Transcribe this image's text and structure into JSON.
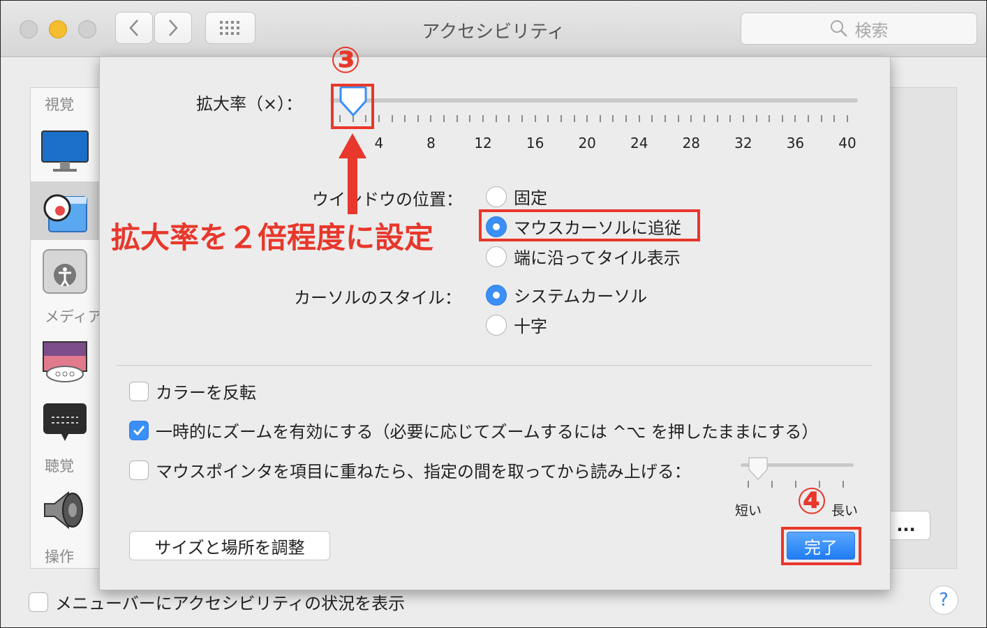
{
  "window": {
    "title": "アクセシビリティ"
  },
  "search": {
    "placeholder": "検索"
  },
  "sidebar": {
    "categories": {
      "vision": "視覚",
      "media": "メディア",
      "hearing": "聴覚",
      "interaction": "操作"
    }
  },
  "options_button_label": "...",
  "bottom": {
    "show_status_label": "メニューバーにアクセシビリティの状況を表示",
    "help_label": "?"
  },
  "sheet": {
    "magnification": {
      "label": "拡大率（×）：",
      "value": 2,
      "min": 1,
      "max": 40,
      "tick_labels": [
        "4",
        "8",
        "12",
        "16",
        "20",
        "24",
        "28",
        "32",
        "36",
        "40"
      ]
    },
    "window_position": {
      "label": "ウインドウの位置：",
      "options": [
        "固定",
        "マウスカーソルに追従",
        "端に沿ってタイル表示"
      ],
      "selected": "マウスカーソルに追従"
    },
    "cursor_style": {
      "label": "カーソルのスタイル：",
      "options": [
        "システムカーソル",
        "十字"
      ],
      "selected": "システムカーソル"
    },
    "invert_colors": {
      "label": "カラーを反転",
      "checked": false
    },
    "temp_zoom": {
      "label": "一時的にズームを有効にする（必要に応じてズームするには ^⌥ を押したままにする）",
      "checked": true
    },
    "speak_under_pointer": {
      "label": "マウスポインタを項目に重ねたら、指定の間を取ってから読み上げる：",
      "checked": false,
      "delay_min_label": "短い",
      "delay_max_label": "長い"
    },
    "adjust_button": "サイズと場所を調整",
    "done_button": "完了"
  },
  "annotations": {
    "step3": "③",
    "step4": "④",
    "instruction": "拡大率を２倍程度に設定",
    "color": "#e8372b"
  }
}
